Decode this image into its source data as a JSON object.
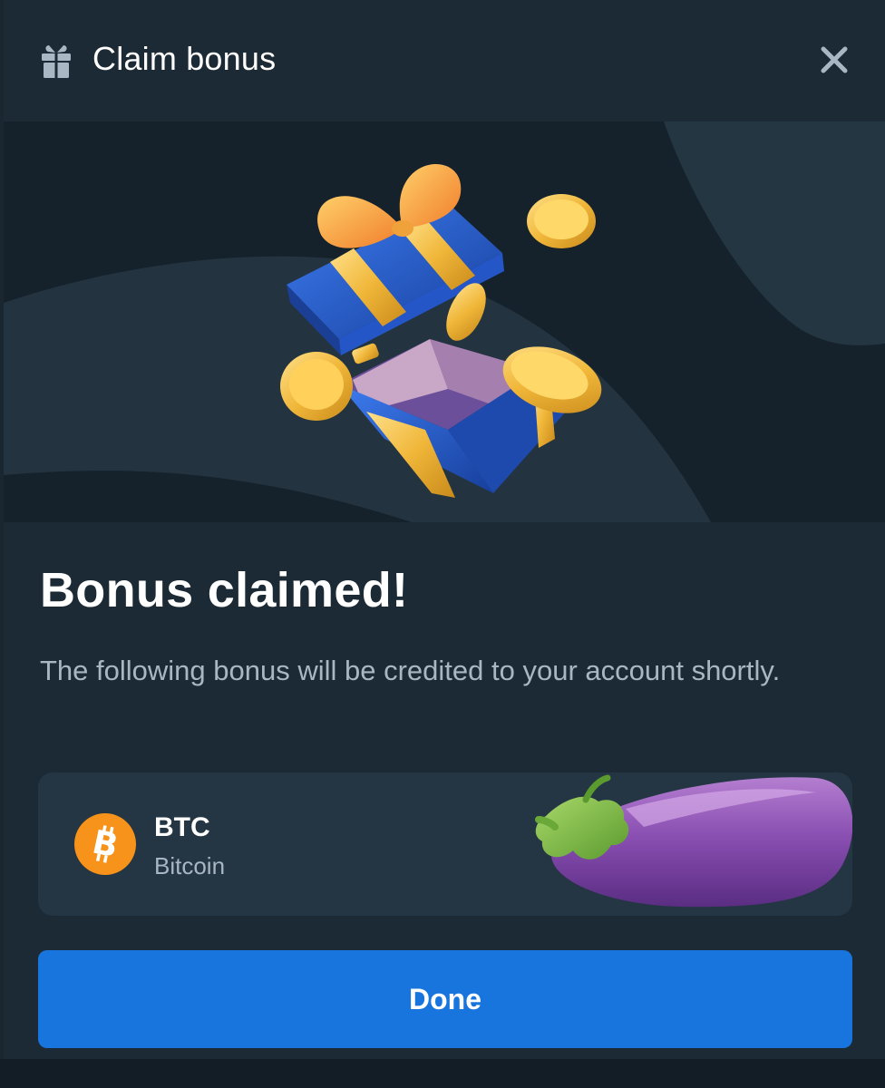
{
  "header": {
    "title": "Claim bonus",
    "icon": "gift-icon",
    "close_icon": "close-icon"
  },
  "hero": {
    "illustration": "open-gift-box-with-coins"
  },
  "main": {
    "headline": "Bonus claimed!",
    "description": "The following bonus will be credited to your account shortly."
  },
  "bonus": {
    "currency_code": "BTC",
    "currency_name": "Bitcoin",
    "currency_icon": "bitcoin-icon",
    "sticker": "eggplant-emoji"
  },
  "actions": {
    "done_label": "Done"
  },
  "colors": {
    "modal_bg": "#1c2a35",
    "hero_bg": "#15222c",
    "card_bg": "#243543",
    "accent_button": "#1775dd",
    "muted_text": "#a9b7c4",
    "bitcoin_orange": "#f7931a"
  }
}
